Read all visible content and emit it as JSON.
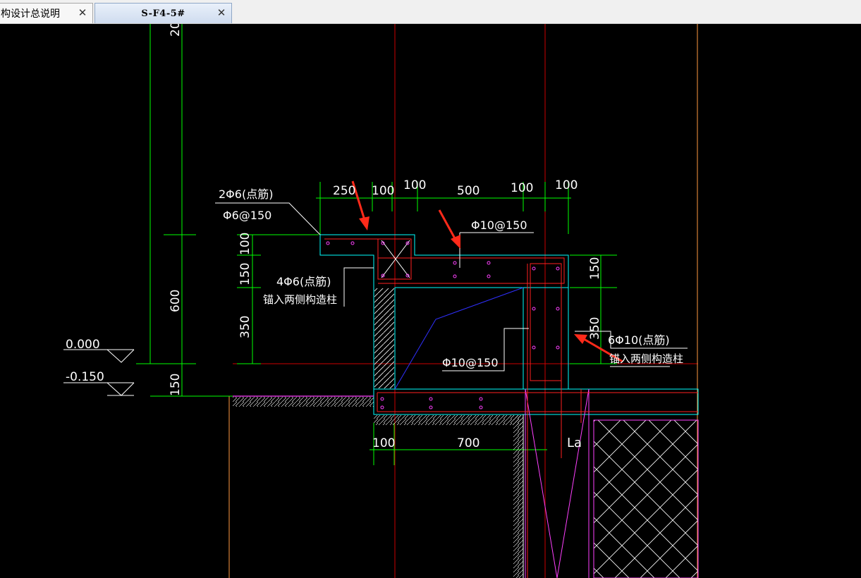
{
  "tabs": [
    {
      "label": "构设计总说明",
      "close": "✕"
    },
    {
      "label": "S-F4-5#",
      "close": "✕"
    }
  ],
  "drawing": {
    "top_dims": [
      "250",
      "100",
      "100",
      "500",
      "100",
      "100"
    ],
    "left_dims": [
      "100",
      "150",
      "350",
      "150"
    ],
    "far_left_dims": [
      "600",
      "20"
    ],
    "right_dims": [
      "150",
      "350"
    ],
    "bottom_dims": [
      "100",
      "700"
    ],
    "elevation_top": "0.000",
    "elevation_bottom": "-0.150",
    "note_2phi6": "2Φ6(点筋)",
    "note_phi6_150": "Φ6@150",
    "note_phi10_150_top": "Φ10@150",
    "note_4phi6": "4Φ6(点筋)",
    "note_4phi6_sub": "锚入两侧构造柱",
    "note_phi10_150_mid": "Φ10@150",
    "note_6phi10": "6Φ10(点筋)",
    "note_6phi10_sub": "锚入两侧构造柱",
    "note_la": "La"
  },
  "colors": {
    "background": "#000000",
    "dimension": "#00ff00",
    "concrete": "#00ffff",
    "rebar": "#ff2020",
    "rebar_dot": "#ff40ff",
    "text": "#ffffff",
    "axis": "#cc0000",
    "arrow": "#ff2a1a",
    "soil": "#ff40ff",
    "slope": "#3030ff"
  }
}
